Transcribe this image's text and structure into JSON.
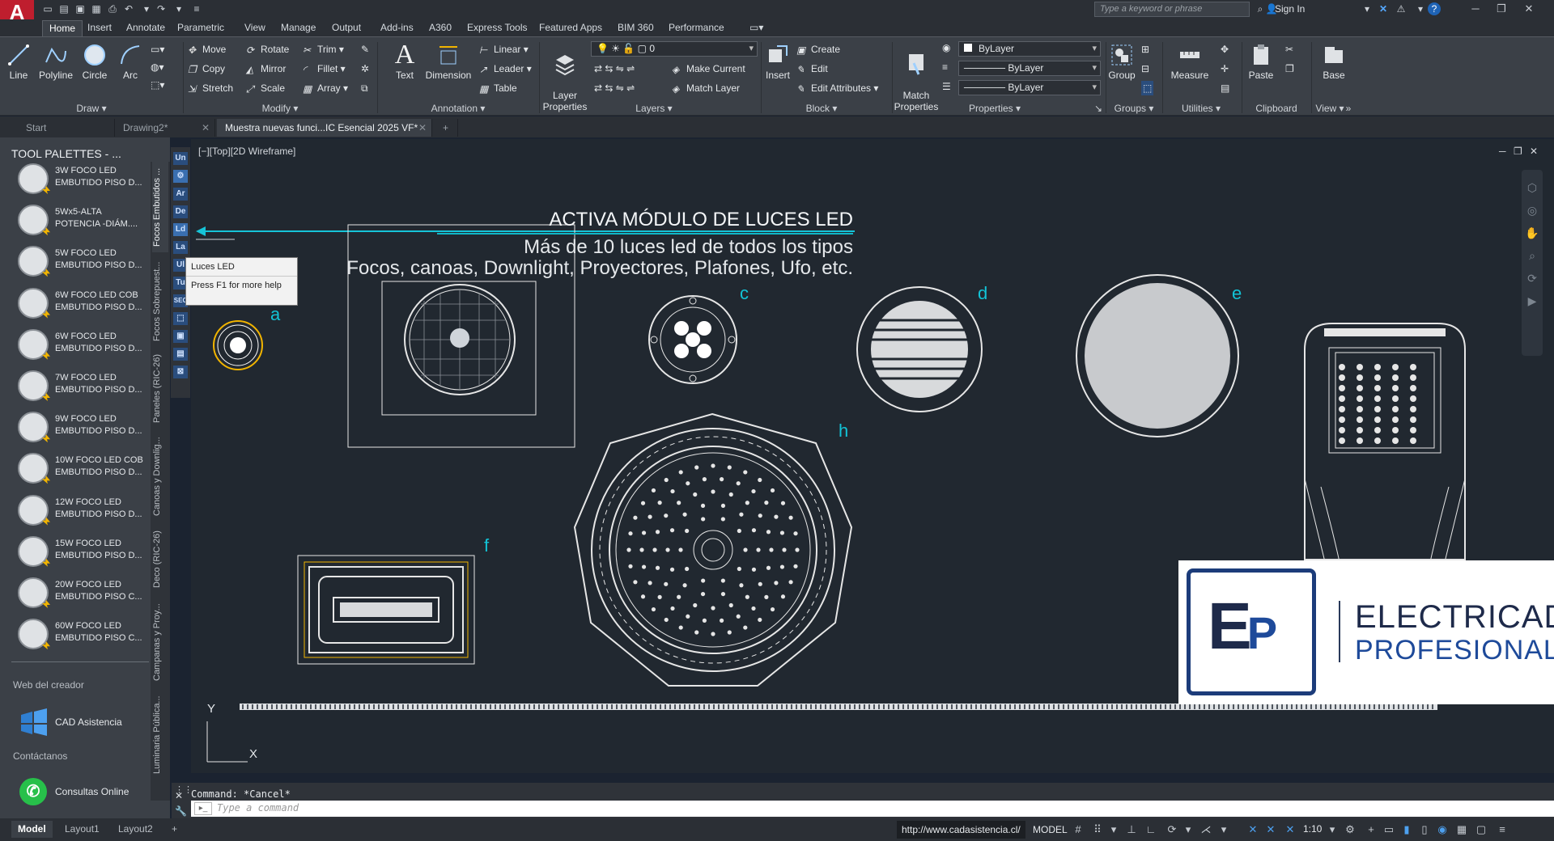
{
  "app": {
    "logo": "A"
  },
  "search": {
    "placeholder": "Type a keyword or phrase"
  },
  "signin": "Sign In",
  "ribbon_tabs": [
    "Home",
    "Insert",
    "Annotate",
    "Parametric",
    "View",
    "Manage",
    "Output",
    "Add-ins",
    "A360",
    "Express Tools",
    "Featured Apps",
    "BIM 360",
    "Performance"
  ],
  "draw": {
    "title": "Draw",
    "line": "Line",
    "polyline": "Polyline",
    "circle": "Circle",
    "arc": "Arc"
  },
  "modify": {
    "title": "Modify",
    "move": "Move",
    "rotate": "Rotate",
    "trim": "Trim",
    "copy": "Copy",
    "mirror": "Mirror",
    "fillet": "Fillet",
    "stretch": "Stretch",
    "scale": "Scale",
    "array": "Array"
  },
  "annotation": {
    "title": "Annotation",
    "text": "Text",
    "dimension": "Dimension",
    "linear": "Linear",
    "leader": "Leader",
    "table": "Table"
  },
  "layers": {
    "title": "Layers",
    "layer_props": "Layer\nProperties",
    "current_layer": "0",
    "make_current": "Make Current",
    "match_layer": "Match Layer"
  },
  "block": {
    "title": "Block",
    "insert": "Insert",
    "create": "Create",
    "edit": "Edit",
    "edit_attributes": "Edit Attributes"
  },
  "properties": {
    "title": "Properties",
    "match": "Match\nProperties",
    "color": "ByLayer",
    "linetype": "ByLayer",
    "lineweight": "ByLayer"
  },
  "groups": {
    "title": "Groups",
    "group": "Group"
  },
  "utilities": {
    "title": "Utilities",
    "measure": "Measure"
  },
  "clipboard": {
    "title": "Clipboard",
    "paste": "Paste"
  },
  "view_panel": {
    "title": "View",
    "base": "Base"
  },
  "doc_tabs": [
    "Start",
    "Drawing2*",
    "Muestra nuevas funci...IC Esencial 2025 VF*"
  ],
  "palette": {
    "title": "TOOL PALETTES - ...",
    "items": [
      {
        "l1": "3W FOCO LED",
        "l2": "EMBUTIDO  PISO  D..."
      },
      {
        "l1": "5Wx5-ALTA",
        "l2": "POTENCIA  -DIÁM...."
      },
      {
        "l1": "5W FOCO LED",
        "l2": "EMBUTIDO  PISO  D..."
      },
      {
        "l1": "6W FOCO LED COB",
        "l2": "EMBUTIDO  PISO  D..."
      },
      {
        "l1": "6W FOCO LED",
        "l2": "EMBUTIDO  PISO  D..."
      },
      {
        "l1": "7W FOCO LED",
        "l2": "EMBUTIDO  PISO  D..."
      },
      {
        "l1": "9W FOCO LED",
        "l2": "EMBUTIDO  PISO  D..."
      },
      {
        "l1": "10W FOCO LED COB",
        "l2": "EMBUTIDO  PISO  D..."
      },
      {
        "l1": "12W FOCO LED",
        "l2": "EMBUTIDO  PISO  D..."
      },
      {
        "l1": "15W FOCO LED",
        "l2": "EMBUTIDO  PISO  D..."
      },
      {
        "l1": "20W FOCO LED",
        "l2": "EMBUTIDO  PISO  C..."
      },
      {
        "l1": "60W FOCO LED",
        "l2": "EMBUTIDO  PISO  C..."
      }
    ],
    "web_label": "Web del creador",
    "cad_asistencia": "CAD Asistencia",
    "contact_label": "Contáctanos",
    "consultas": "Consultas Online",
    "vtabs": [
      "Focos Embutidos ...",
      "Focos Sobrepuest...",
      "Paneles (RIC-26)",
      "Canoas y Downlig...",
      "Deco (RIC-26)",
      "Campanas y Proy...",
      "Luminaria Pública..."
    ]
  },
  "side_buttons": [
    "Un",
    "Ar",
    "De",
    "Ld",
    "La",
    "Ul",
    "Tu",
    "SEC"
  ],
  "tooltip": {
    "title": "Luces LED",
    "help": "Press F1 for more help"
  },
  "viewport_label": "[−][Top][2D Wireframe]",
  "banner": {
    "title": "ACTIVA MÓDULO DE LUCES LED",
    "line1": "Más de 10 luces led de todos los tipos",
    "line2": "Focos, canoas, Downlight, Proyectores, Plafones, Ufo, etc."
  },
  "letters": [
    "a",
    "c",
    "d",
    "e",
    "f",
    "h"
  ],
  "axes": {
    "y": "Y",
    "x": "X"
  },
  "brand": {
    "initials_1": "E",
    "initials_2": "P",
    "line1": "ELECTRICAD",
    "line2": "PROFESIONAL"
  },
  "command": {
    "history": "Command: *Cancel*",
    "placeholder": "Type a command"
  },
  "layout_tabs": [
    "Model",
    "Layout1",
    "Layout2"
  ],
  "status": {
    "url": "http://www.cadasistencia.cl/",
    "model": "MODEL",
    "scale": "1:10"
  }
}
